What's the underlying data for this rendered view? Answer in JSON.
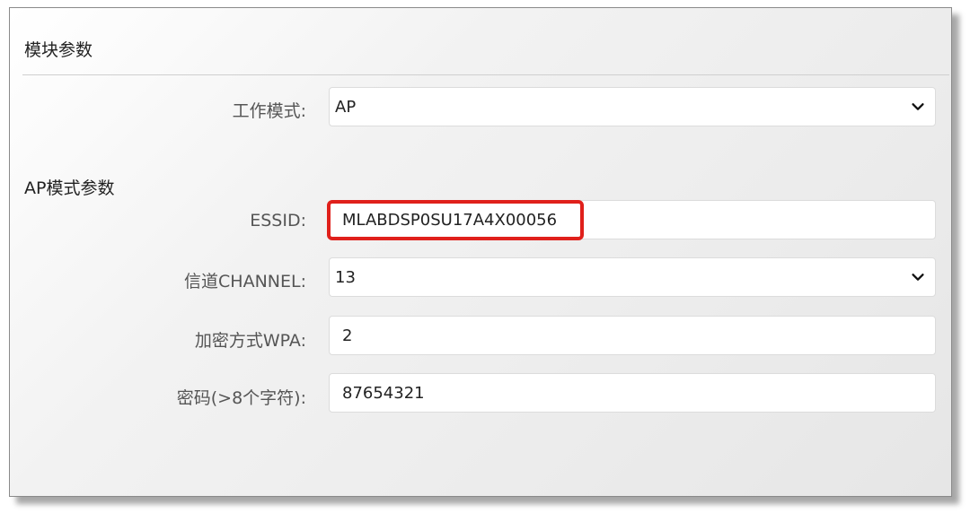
{
  "module_params": {
    "title": "模块参数",
    "work_mode": {
      "label": "工作模式:",
      "value": "AP"
    }
  },
  "ap_params": {
    "title": "AP模式参数",
    "essid": {
      "label": "ESSID:",
      "value": "MLABDSP0SU17A4X00056"
    },
    "channel": {
      "label": "信道CHANNEL:",
      "value": "13"
    },
    "wpa": {
      "label": "加密方式WPA:",
      "value": "2"
    },
    "password": {
      "label": "密码(>8个字符):",
      "value": "87654321"
    }
  },
  "colors": {
    "highlight": "#e0201b"
  },
  "icons": {
    "select_arrow": "chevron-down-icon"
  }
}
